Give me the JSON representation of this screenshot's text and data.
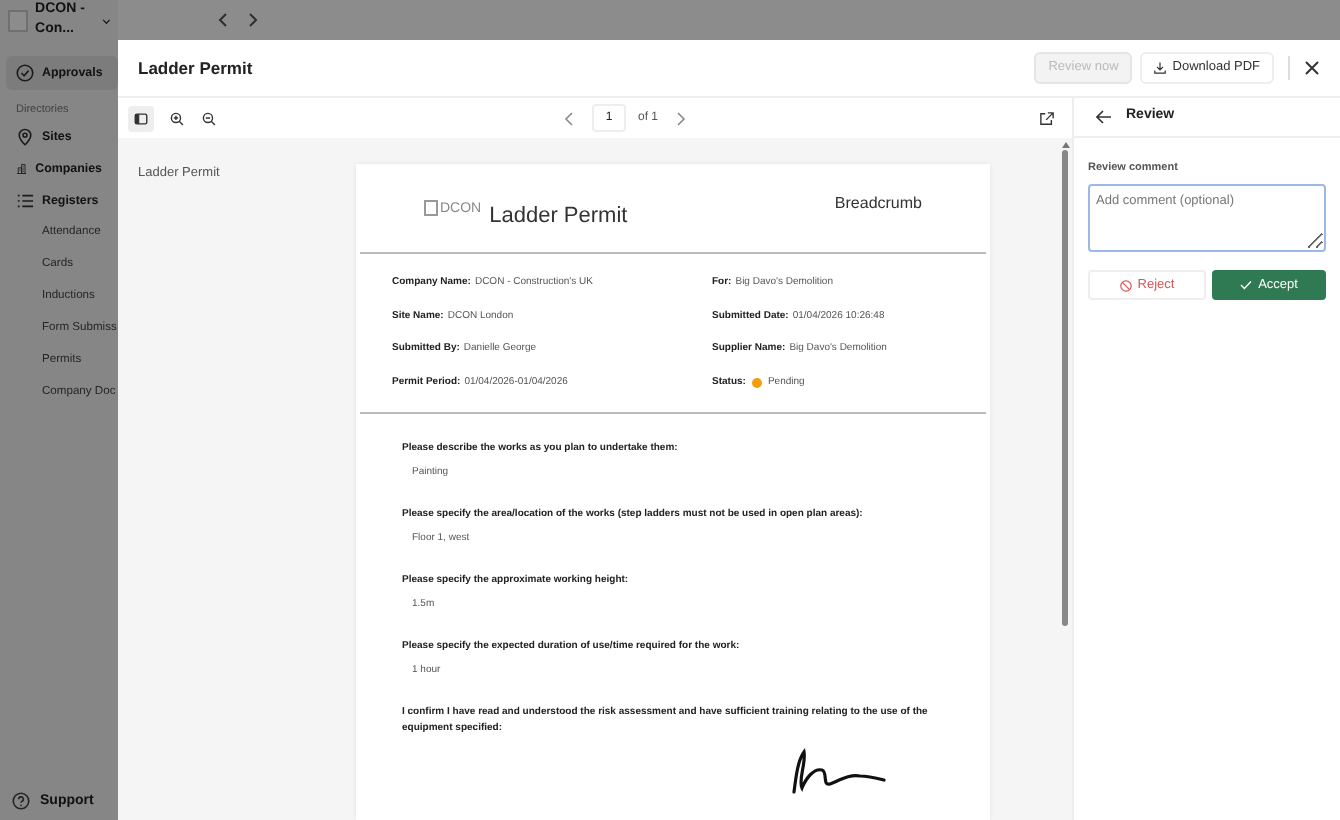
{
  "app": {
    "workspace": "DCON - Con...",
    "nav": [
      {
        "kind": "main",
        "label": "Approvals",
        "selected": true
      },
      {
        "kind": "heading",
        "label": "Directories"
      },
      {
        "kind": "main",
        "label": "Sites",
        "selected": false
      },
      {
        "kind": "main",
        "label": "Companies",
        "selected": false
      },
      {
        "kind": "main",
        "label": "Registers",
        "selected": false
      },
      {
        "kind": "sub",
        "label": "Attendance",
        "selected": false
      },
      {
        "kind": "sub",
        "label": "Cards",
        "selected": false
      },
      {
        "kind": "sub",
        "label": "Inductions",
        "selected": false
      },
      {
        "kind": "sub",
        "label": "Form Submiss",
        "selected": false
      },
      {
        "kind": "sub",
        "label": "Permits",
        "selected": false
      },
      {
        "kind": "sub",
        "label": "Company Doc",
        "selected": false
      }
    ],
    "support": "Support"
  },
  "modal": {
    "title": "Ladder Permit",
    "buttons": [
      {
        "label": "Review now",
        "disabled": true
      },
      {
        "label": "Download PDF",
        "disabled": false
      }
    ],
    "toolbar": {
      "page": "1",
      "of": "of 1"
    },
    "outline": [
      "Ladder Permit"
    ],
    "document": {
      "logo_text": "DCON",
      "title": "Ladder Permit",
      "brand": "Breadcrumb",
      "fields": [
        {
          "label": "Company Name:",
          "value": "DCON - Construction's UK"
        },
        {
          "label": "For:",
          "value": "Big Davo's Demolition"
        },
        {
          "label": "Site Name:",
          "value": "DCON London"
        },
        {
          "label": "Submitted Date:",
          "value": "01/04/2026 10:26:48"
        },
        {
          "label": "Submitted By:",
          "value": "Danielle George"
        },
        {
          "label": "Supplier Name:",
          "value": "Big Davo's Demolition"
        },
        {
          "label": "Permit Period:",
          "value": "01/04/2026-01/04/2026"
        },
        {
          "label": "Status:",
          "value": "Pending",
          "color": "#f59e0b"
        }
      ],
      "questions": [
        {
          "kind": "text",
          "question": "Please describe the works as you plan to undertake them:",
          "answer": "Painting"
        },
        {
          "kind": "text",
          "question": "Please specify the area/location of the works (step ladders must not be used in open plan areas):",
          "answer": "Floor 1, west"
        },
        {
          "kind": "text",
          "question": "Please specify the approximate working height:",
          "answer": "1.5m"
        },
        {
          "kind": "text",
          "question": "Please specify the expected duration of use/time required for the work:",
          "answer": "1 hour"
        },
        {
          "kind": "signature",
          "question": "I confirm I have read and understood the risk assessment and have sufficient training relating to the use of the equipment specified:"
        }
      ]
    },
    "review": {
      "title": "Review",
      "comment_label": "Review comment",
      "placeholder": "Add comment (optional)",
      "reject": "Reject",
      "accept": "Accept"
    }
  }
}
